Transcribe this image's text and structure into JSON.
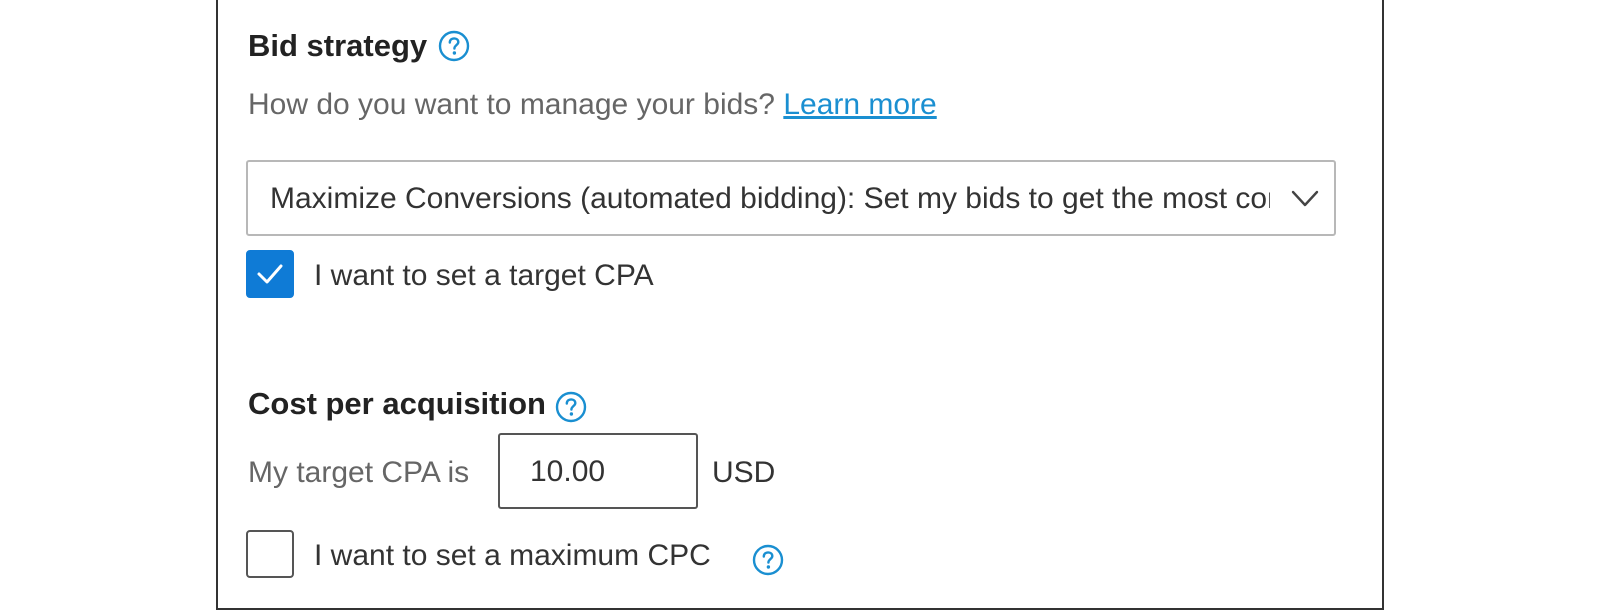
{
  "bid_strategy": {
    "heading": "Bid strategy",
    "help_icon": "question-circle-icon",
    "question": "How do you want to manage your bids?",
    "learn_more_link": "Learn more",
    "dropdown": {
      "selected": "Maximize Conversions (automated bidding): Set my bids to get the most conversions",
      "icon": "chevron-down-icon"
    },
    "target_cpa_checkbox": {
      "checked": true,
      "label": "I want to set a target CPA"
    }
  },
  "cost_per_acquisition": {
    "heading": "Cost per acquisition",
    "help_icon": "question-circle-icon",
    "target_label": "My target CPA is",
    "target_value": "10.00",
    "currency": "USD",
    "max_cpc_checkbox": {
      "checked": false,
      "label": "I want to set a maximum CPC",
      "help_icon": "question-circle-icon"
    }
  },
  "colors": {
    "accent": "#0f7bd6",
    "link": "#1a8fd1",
    "border": "#333333"
  }
}
